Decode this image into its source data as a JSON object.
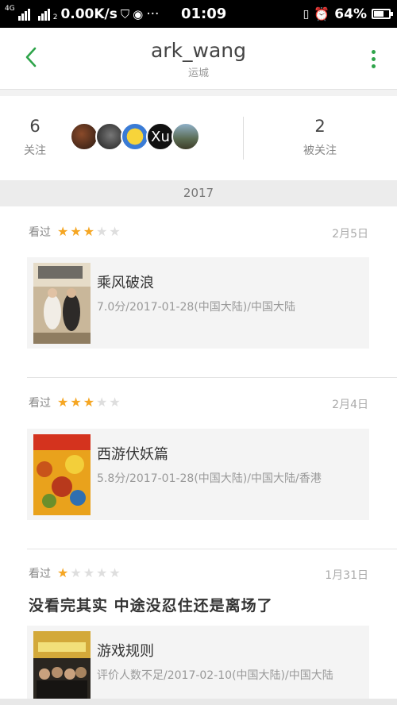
{
  "status_bar": {
    "network_type": "4G",
    "sim_slot": "2",
    "speed": "0.00K/s",
    "dots": "···",
    "time": "01:09",
    "battery": "64%",
    "battery_level": 0.64
  },
  "header": {
    "title": "ark_wang",
    "subtitle": "运城",
    "accent_color": "#2ea44a"
  },
  "follow": {
    "following_count": "6",
    "following_label": "关注",
    "avatar_text": "Xu",
    "followers_count": "2",
    "followers_label": "被关注"
  },
  "year": "2017",
  "entries": [
    {
      "status": "看过",
      "rating": 3,
      "date": "2月5日",
      "title": "乘风破浪",
      "info": "7.0分/2017-01-28(中国大陆)/中国大陆",
      "comment": ""
    },
    {
      "status": "看过",
      "rating": 3,
      "date": "2月4日",
      "title": "西游伏妖篇",
      "info": "5.8分/2017-01-28(中国大陆)/中国大陆/香港",
      "comment": ""
    },
    {
      "status": "看过",
      "rating": 1,
      "date": "1月31日",
      "title": "游戏规则",
      "info": "评价人数不足/2017-02-10(中国大陆)/中国大陆",
      "comment": "没看完其实 中途没忍住还是离场了"
    }
  ],
  "star_color": "#f5a623"
}
